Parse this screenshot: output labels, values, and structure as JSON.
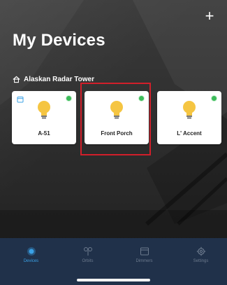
{
  "header": {
    "title": "My Devices",
    "add_icon": "plus-icon"
  },
  "location": {
    "name": "Alaskan Radar Tower",
    "icon": "home-icon"
  },
  "devices": [
    {
      "name": "A-51",
      "icon": "bulb-icon",
      "status_color": "#3dbb5a",
      "has_schedule_icon": true
    },
    {
      "name": "Front Porch",
      "icon": "bulb-icon",
      "status_color": "#3dbb5a",
      "has_schedule_icon": false
    },
    {
      "name": "L' Accent",
      "icon": "bulb-icon",
      "status_color": "#3dbb5a",
      "has_schedule_icon": false
    }
  ],
  "tabbar": {
    "tabs": [
      {
        "label": "Devices",
        "icon": "device-dot-icon",
        "active": true
      },
      {
        "label": "Orbits",
        "icon": "orbits-icon",
        "active": false
      },
      {
        "label": "Dimmers",
        "icon": "dimmer-icon",
        "active": false
      },
      {
        "label": "Settings",
        "icon": "gear-icon",
        "active": false
      }
    ]
  },
  "colors": {
    "bulb": "#f5c542",
    "active_tab": "#3aa1e6",
    "inactive_tab": "#6c7a8d",
    "tabbar_bg": "#20314a",
    "highlight_box": "#d11f2a"
  }
}
